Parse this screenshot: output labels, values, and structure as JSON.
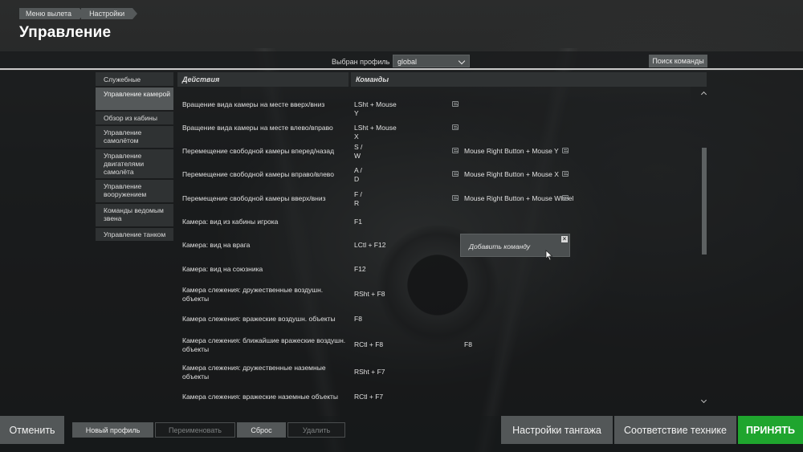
{
  "breadcrumb": [
    "Меню вылета",
    "Настройки"
  ],
  "page_title": "Управление",
  "profile": {
    "label": "Выбран профиль",
    "selected": "global",
    "search_button": "Поиск команды"
  },
  "sidebar": {
    "items": [
      {
        "label": "Служебные",
        "active": false
      },
      {
        "label": "Управление камерой",
        "active": true
      },
      {
        "label": "Обзор из кабины",
        "active": false
      },
      {
        "label": "Управление самолётом",
        "active": false
      },
      {
        "label": "Управление двигателями самолёта",
        "active": false
      },
      {
        "label": "Управление вооружением",
        "active": false
      },
      {
        "label": "Команды ведомым звена",
        "active": false
      },
      {
        "label": "Управление танком",
        "active": false
      }
    ]
  },
  "table": {
    "header_actions": "Действия",
    "header_commands": "Команды",
    "rows": [
      {
        "action": "Вращение вида камеры на месте вверх/вниз",
        "cmd": "LSht + Mouse Y",
        "cmd2": ""
      },
      {
        "action": "Вращение вида камеры на месте влево/вправо",
        "cmd": "LSht + Mouse X",
        "cmd2": ""
      },
      {
        "action": "Перемещение свободной камеры вперед/назад",
        "cmd": "S / W",
        "cmd2": "Mouse Right Button + Mouse Y"
      },
      {
        "action": "Перемещение свободной камеры вправо/влево",
        "cmd": "A / D",
        "cmd2": "Mouse Right Button + Mouse X"
      },
      {
        "action": "Перемещение свободной камеры вверх/вниз",
        "cmd": "F / R",
        "cmd2": "Mouse Right Button + Mouse Wheel"
      },
      {
        "action": "Камера: вид из кабины игрока",
        "cmd": "F1",
        "cmd2": ""
      },
      {
        "action": "Камера: вид на врага",
        "cmd": "LCtl + F12",
        "cmd2": ""
      },
      {
        "action": "Камера: вид на союзника",
        "cmd": "F12",
        "cmd2": ""
      },
      {
        "action": "Камера слежения: дружественные воздушн. объекты",
        "cmd": "RSht + F8",
        "cmd2": ""
      },
      {
        "action": "Камера слежения: вражеские воздушн. объекты",
        "cmd": "F8",
        "cmd2": ""
      },
      {
        "action": "Камера слежения: ближайшие вражеские воздушн. объекты",
        "cmd": "RCtl + F8",
        "cmd2": "F8"
      },
      {
        "action": "Камера слежения: дружественные наземные объекты",
        "cmd": "RSht + F7",
        "cmd2": ""
      },
      {
        "action": "Камера слежения: вражеские наземные объекты",
        "cmd": "RCtl + F7",
        "cmd2": ""
      }
    ]
  },
  "popup": {
    "add_command": "Добавить команду",
    "close_glyph": "×"
  },
  "footer": {
    "cancel": "Отменить",
    "new_profile": "Новый профиль",
    "rename": "Переименовать",
    "reset": "Сброс",
    "delete": "Удалить",
    "pitch_settings": "Настройки тангажа",
    "match_vehicle": "Соответствие технике",
    "accept": "ПРИНЯТЬ"
  },
  "colors": {
    "accent_green": "#1fa52e",
    "button_gray": "#535758",
    "panel_dark": "#2f3233"
  }
}
